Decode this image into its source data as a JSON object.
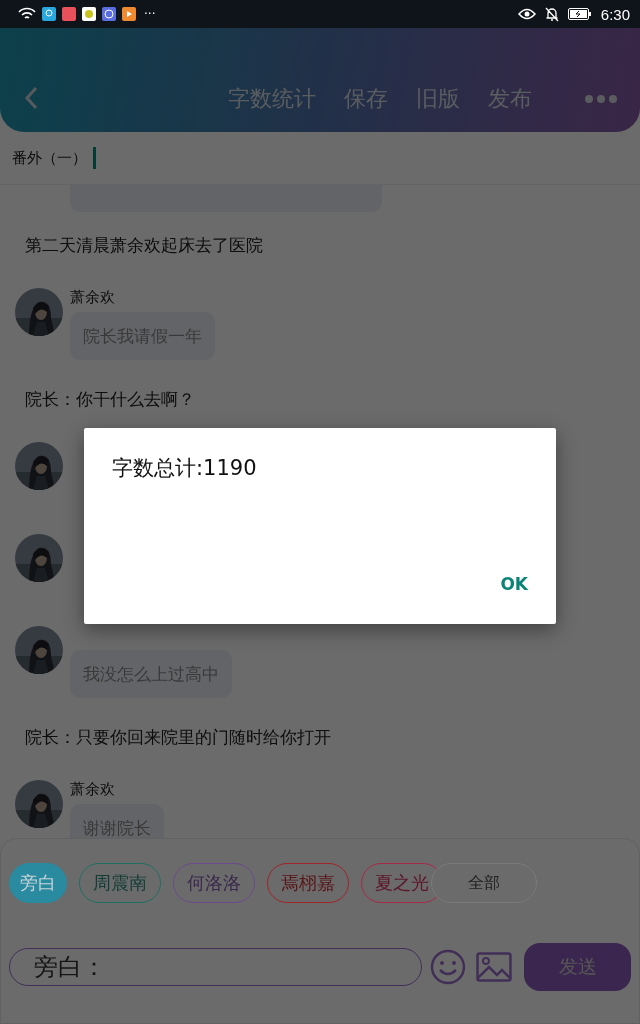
{
  "status_bar": {
    "more": "···",
    "time": "6:30"
  },
  "header": {
    "actions": [
      "字数统计",
      "保存",
      "旧版",
      "发布"
    ]
  },
  "title": {
    "value": "番外（一）"
  },
  "messages": [
    {
      "kind": "cut-bubble"
    },
    {
      "kind": "narration",
      "text": "第二天清晨萧余欢起床去了医院"
    },
    {
      "kind": "line",
      "name": "萧余欢",
      "text": "院长我请假一年"
    },
    {
      "kind": "narration",
      "text": "院长：你干什么去啊？"
    },
    {
      "kind": "covered"
    },
    {
      "kind": "covered"
    },
    {
      "kind": "line",
      "text": "我没怎么上过高中"
    },
    {
      "kind": "narration",
      "text": "院长：只要你回来院里的门随时给你打开"
    },
    {
      "kind": "line",
      "name": "萧余欢",
      "text": "谢谢院长"
    }
  ],
  "roles": [
    {
      "label": "旁白",
      "color": "#2a8aa0",
      "selected": true
    },
    {
      "label": "周震南",
      "color": "#1e6f62",
      "selected": false
    },
    {
      "label": "何洛洛",
      "color": "#6a4a8a",
      "selected": false
    },
    {
      "label": "焉栩嘉",
      "color": "#a02428",
      "selected": false
    },
    {
      "label": "夏之光",
      "color": "#a82848",
      "selected": false
    }
  ],
  "all_button": "全部",
  "composer": {
    "placeholder": "旁白：",
    "send": "发送"
  },
  "dialog": {
    "message": "字数总计:1190",
    "ok": "OK"
  }
}
